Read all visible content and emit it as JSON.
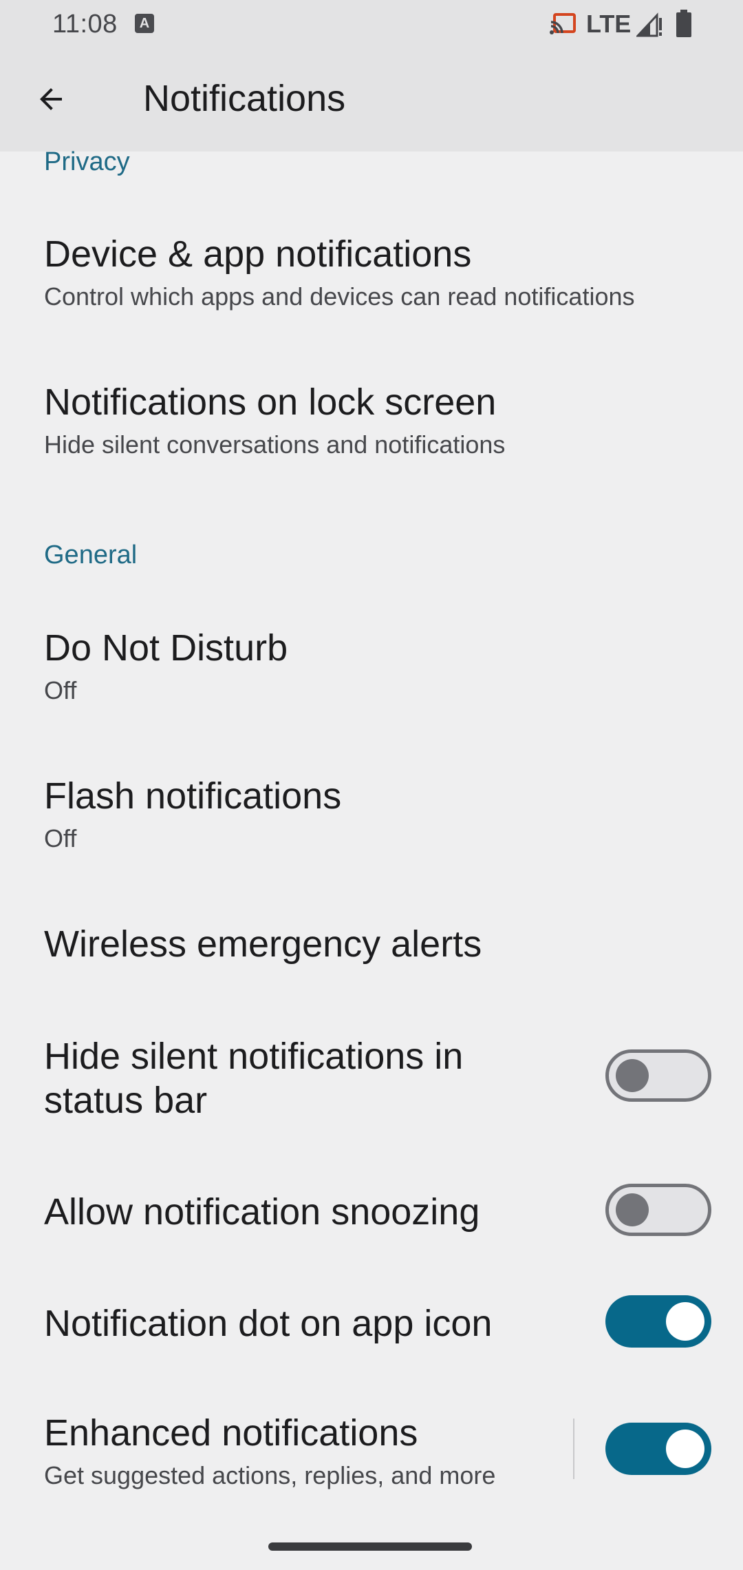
{
  "status_bar": {
    "time": "11:08",
    "notification_icon_glyph": "A",
    "network": "LTE",
    "icons": [
      "a-notification-icon",
      "cast-icon",
      "signal-icon",
      "battery-icon"
    ]
  },
  "app_bar": {
    "title": "Notifications",
    "back_icon": "arrow-back-icon"
  },
  "sections": {
    "privacy": {
      "header": "Privacy",
      "items": [
        {
          "title": "Device & app notifications",
          "summary": "Control which apps and devices can read notifications"
        },
        {
          "title": "Notifications on lock screen",
          "summary": "Hide silent conversations and notifications"
        }
      ]
    },
    "general": {
      "header": "General",
      "items": [
        {
          "title": "Do Not Disturb",
          "summary": "Off"
        },
        {
          "title": "Flash notifications",
          "summary": "Off"
        },
        {
          "title": "Wireless emergency alerts"
        },
        {
          "title": "Hide silent notifications in status bar",
          "toggle": false
        },
        {
          "title": "Allow notification snoozing",
          "toggle": false
        },
        {
          "title": "Notification dot on app icon",
          "toggle": true
        },
        {
          "title": "Enhanced notifications",
          "summary": "Get suggested actions, replies, and more",
          "toggle": true
        }
      ]
    }
  },
  "colors": {
    "accent": "#07688a",
    "section_header": "#1f6a86",
    "background": "#efeff0",
    "app_bar": "#e3e3e4"
  }
}
